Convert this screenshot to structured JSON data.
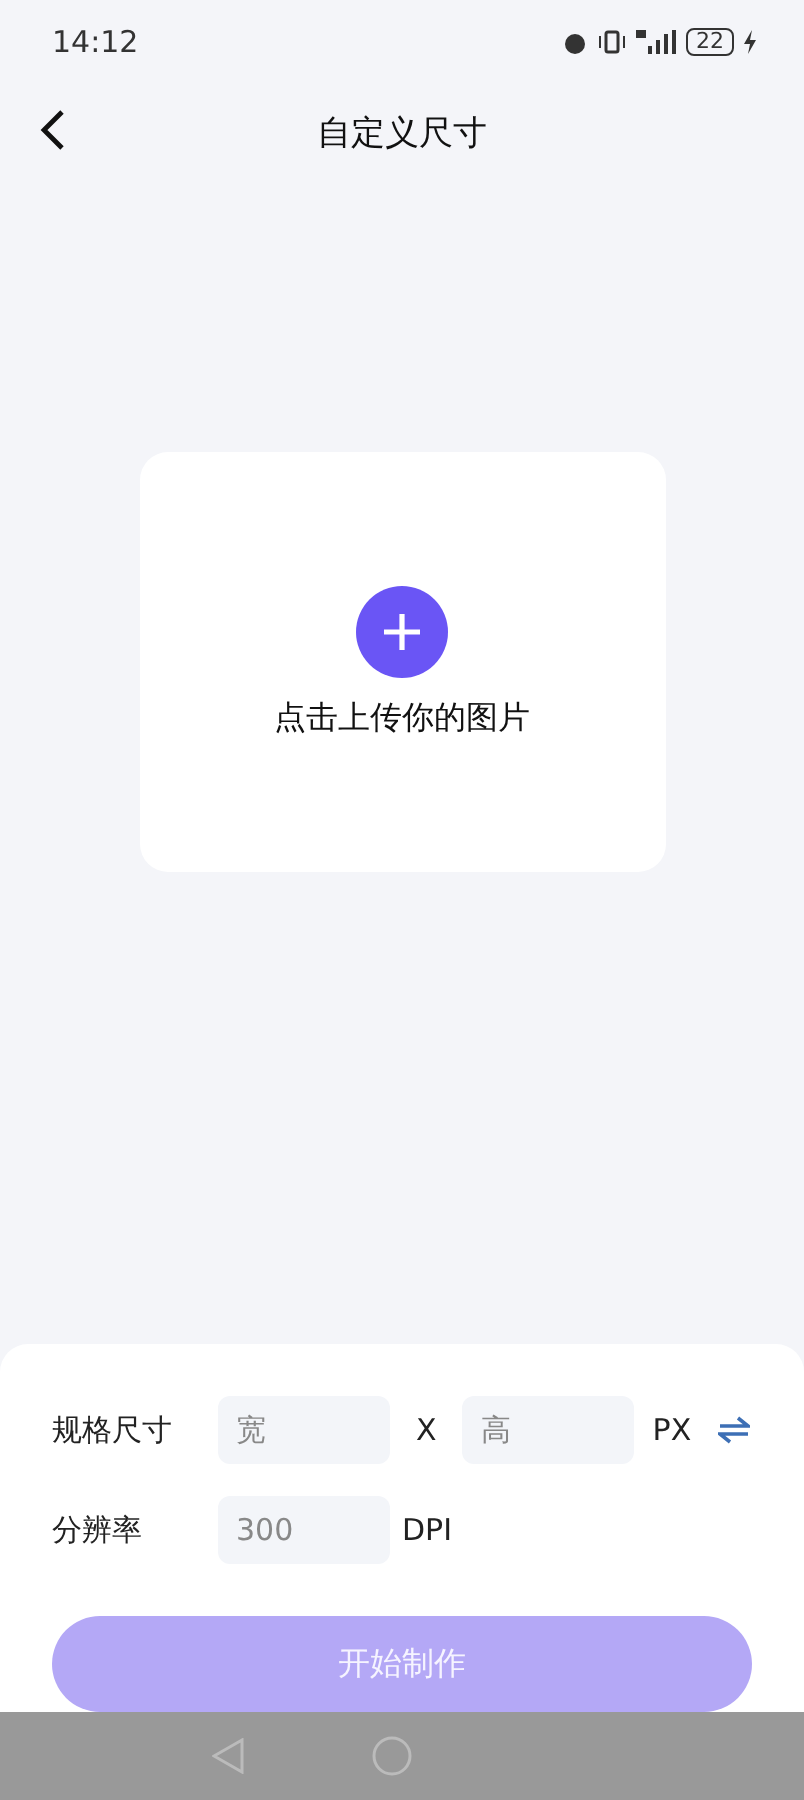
{
  "status_bar": {
    "time": "14:12",
    "battery": "22"
  },
  "header": {
    "title": "自定义尺寸"
  },
  "upload": {
    "label": "点击上传你的图片"
  },
  "form": {
    "size_label": "规格尺寸",
    "width": {
      "placeholder": "宽"
    },
    "separator": "X",
    "height": {
      "placeholder": "高"
    },
    "unit": "PX",
    "resolution_label": "分辨率",
    "resolution": {
      "value": "300"
    },
    "resolution_unit": "DPI"
  },
  "start_button": {
    "label": "开始制作",
    "disabled": true
  }
}
